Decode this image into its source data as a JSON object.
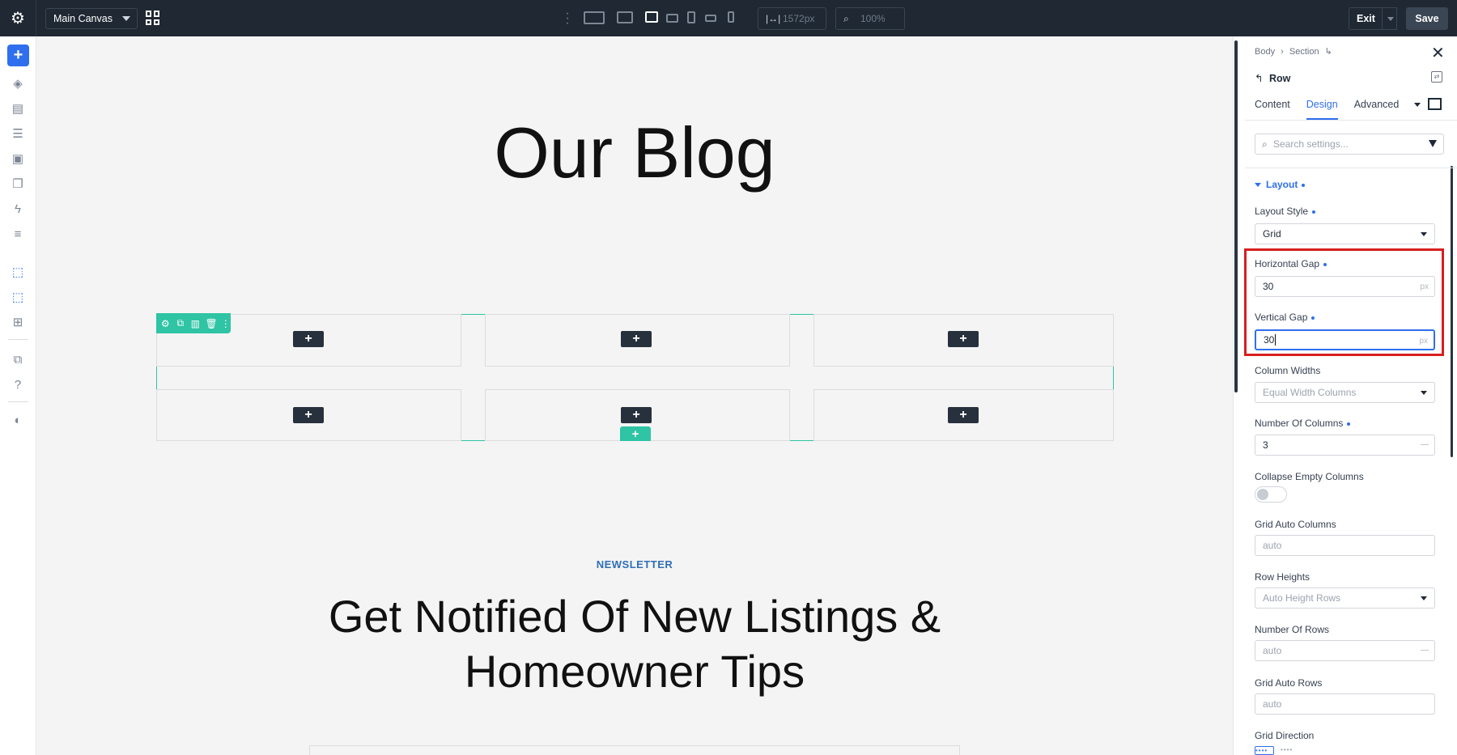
{
  "topbar": {
    "canvas_select": "Main Canvas",
    "width_value": "1572px",
    "zoom_value": "100%",
    "exit_label": "Exit",
    "save_label": "Save"
  },
  "canvas": {
    "blog_title": "Our Blog",
    "newsletter_label": "NEWSLETTER",
    "newsletter_title": "Get Notified Of New Listings & Homeowner Tips",
    "add_symbol": "+"
  },
  "panel": {
    "breadcrumb": [
      "Body",
      "Section"
    ],
    "element_name": "Row",
    "tabs": [
      {
        "label": "Content"
      },
      {
        "label": "Design"
      },
      {
        "label": "Advanced"
      }
    ],
    "search_placeholder": "Search settings...",
    "section_title": "Layout",
    "fields": {
      "layout_style": {
        "label": "Layout Style",
        "value": "Grid"
      },
      "horizontal_gap": {
        "label": "Horizontal Gap",
        "value": "30",
        "unit": "px"
      },
      "vertical_gap": {
        "label": "Vertical Gap",
        "value": "30",
        "unit": "px"
      },
      "column_widths": {
        "label": "Column Widths",
        "value": "Equal Width Columns"
      },
      "number_of_columns": {
        "label": "Number Of Columns",
        "value": "3"
      },
      "collapse_empty_columns": {
        "label": "Collapse Empty Columns",
        "value": false
      },
      "grid_auto_columns": {
        "label": "Grid Auto Columns",
        "value": "auto"
      },
      "row_heights": {
        "label": "Row Heights",
        "value": "Auto Height Rows"
      },
      "number_of_rows": {
        "label": "Number Of Rows",
        "value": "auto"
      },
      "grid_auto_rows": {
        "label": "Grid Auto Rows",
        "value": "auto"
      },
      "grid_direction": {
        "label": "Grid Direction"
      }
    }
  },
  "colors": {
    "accent": "#2f6fed",
    "row_outline": "#2ec4a4",
    "highlight": "#d81e1e",
    "topbar": "#1f2833"
  }
}
